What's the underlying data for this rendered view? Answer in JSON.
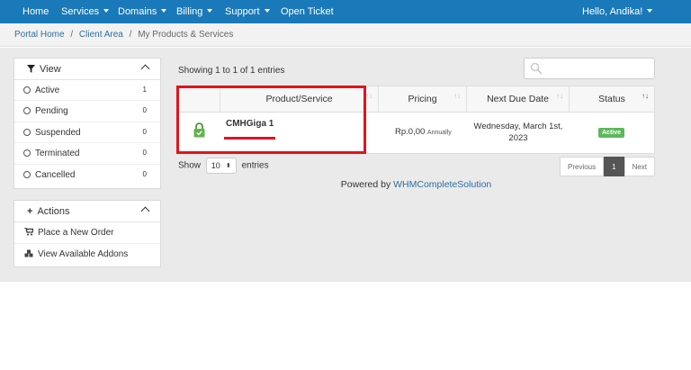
{
  "topnav": {
    "home": "Home",
    "services": "Services",
    "domains": "Domains",
    "billing": "Billing",
    "support": "Support",
    "open_ticket": "Open Ticket",
    "greeting": "Hello, Andika!"
  },
  "breadcrumb": {
    "portal_home": "Portal Home",
    "client_area": "Client Area",
    "current": "My Products & Services",
    "separator": "/"
  },
  "view_panel": {
    "title": "View",
    "items": [
      {
        "label": "Active",
        "count": "1"
      },
      {
        "label": "Pending",
        "count": "0"
      },
      {
        "label": "Suspended",
        "count": "0"
      },
      {
        "label": "Terminated",
        "count": "0"
      },
      {
        "label": "Cancelled",
        "count": "0"
      }
    ]
  },
  "actions_panel": {
    "title": "Actions",
    "items": [
      {
        "label": "Place a New Order",
        "icon": "cart-icon"
      },
      {
        "label": "View Available Addons",
        "icon": "cubes-icon"
      }
    ]
  },
  "table": {
    "showing": "Showing 1 to 1 of 1 entries",
    "columns": [
      "Product/Service",
      "Pricing",
      "Next Due Date",
      "Status"
    ],
    "rows": [
      {
        "product": "CMHGiga 1",
        "price": "Rp.0,00",
        "cycle": "Annually",
        "due_line1": "Wednesday, March 1st,",
        "due_line2": "2023",
        "status": "Active"
      }
    ]
  },
  "length": {
    "show": "Show",
    "value": "10",
    "entries": "entries"
  },
  "pagination": {
    "previous": "Previous",
    "page": "1",
    "next": "Next"
  },
  "footer": {
    "powered_by": "Powered by",
    "link": "WHMCompleteSolution"
  },
  "colors": {
    "nav": "#1a79b8",
    "active_badge": "#5cb85c",
    "annotation_red": "#e3131b"
  }
}
